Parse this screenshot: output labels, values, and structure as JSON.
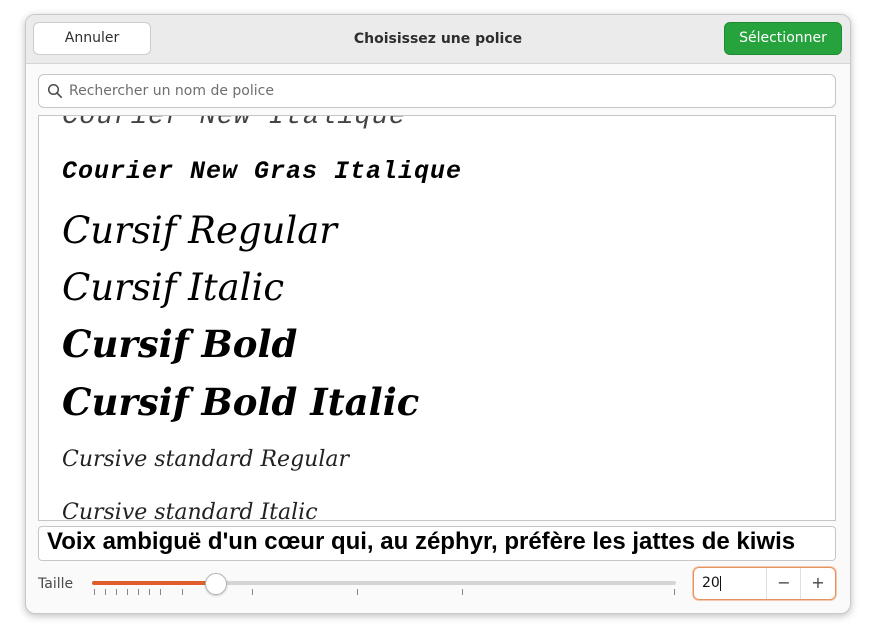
{
  "header": {
    "cancel_label": "Annuler",
    "title": "Choisissez une police",
    "select_label": "Sélectionner",
    "accent_color": "#26a33d"
  },
  "search": {
    "placeholder": "Rechercher un nom de police",
    "value": "",
    "icon": "search-icon"
  },
  "font_list": {
    "items": [
      {
        "name": "Courier New Italique"
      },
      {
        "name": "Courier New Gras Italique"
      },
      {
        "name": "Cursif Regular"
      },
      {
        "name": "Cursif Italic"
      },
      {
        "name": "Cursif Bold"
      },
      {
        "name": "Cursif Bold Italic"
      },
      {
        "name": "Cursive standard Regular"
      },
      {
        "name": "Cursive standard Italic"
      }
    ]
  },
  "preview": {
    "text": "Voix ambiguë d'un cœur qui, au zéphyr, préfère les jattes de kiwis"
  },
  "size": {
    "label": "Taille",
    "value": "20",
    "slider_fraction": 0.21,
    "slider_color": "#e05d2c",
    "minus_label": "−",
    "plus_label": "+"
  }
}
